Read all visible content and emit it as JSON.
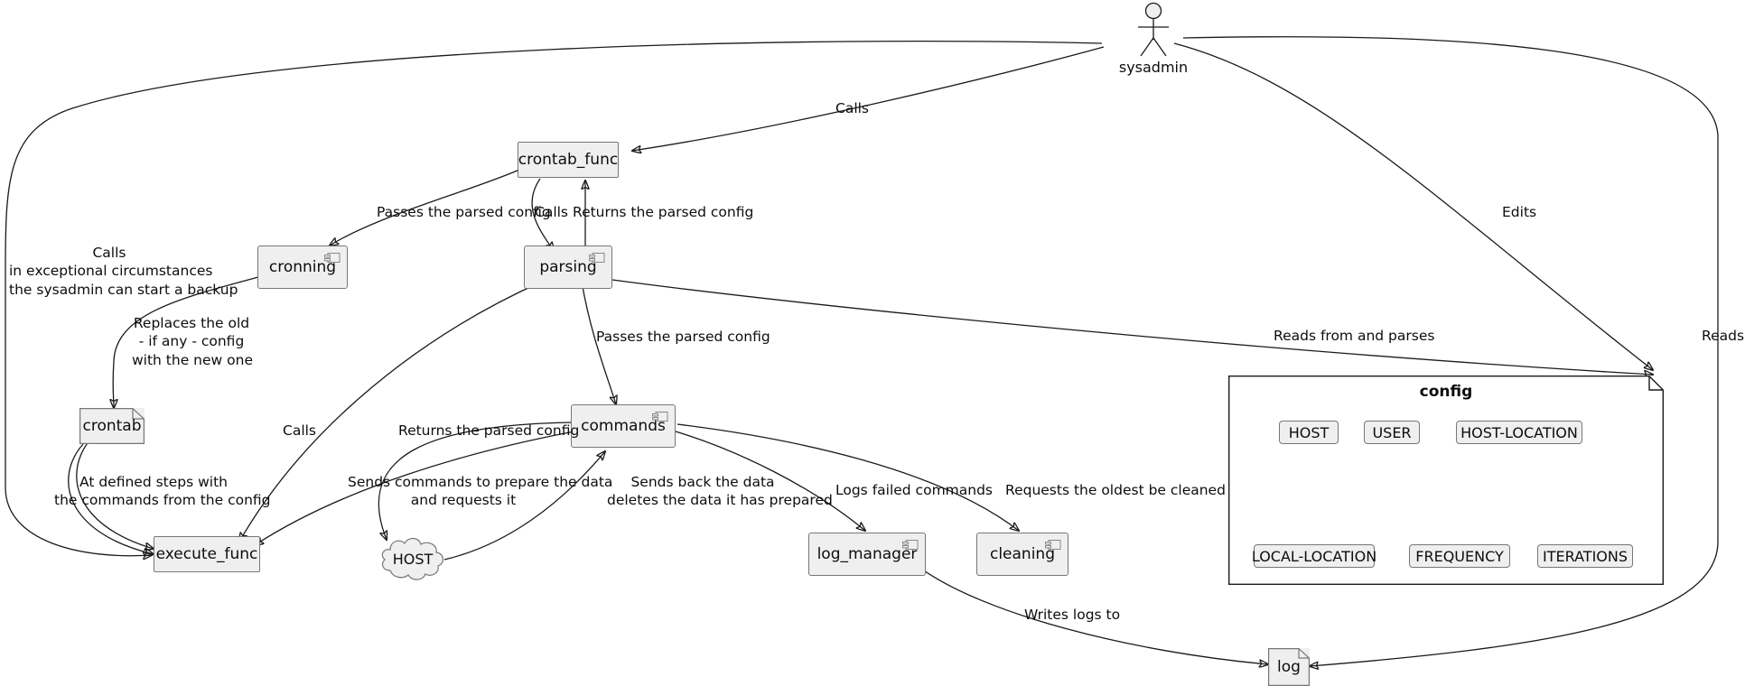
{
  "diagram": {
    "type": "uml-component-diagram",
    "background": "#ffffff",
    "node_fill": "#efefef",
    "node_stroke": "#777777",
    "edge_stroke": "#1a1a1a"
  },
  "actor": {
    "name": "sysadmin",
    "icon": "actor-stick-figure"
  },
  "components": [
    {
      "id": "crontab_func",
      "label": "crontab_func",
      "shape": "box",
      "has_component_icon": false
    },
    {
      "id": "cronning",
      "label": "cronning",
      "shape": "component",
      "has_component_icon": true
    },
    {
      "id": "parsing",
      "label": "parsing",
      "shape": "component",
      "has_component_icon": true
    },
    {
      "id": "commands",
      "label": "commands",
      "shape": "component",
      "has_component_icon": true
    },
    {
      "id": "log_manager",
      "label": "log_manager",
      "shape": "component",
      "has_component_icon": true
    },
    {
      "id": "cleaning",
      "label": "cleaning",
      "shape": "component",
      "has_component_icon": true
    },
    {
      "id": "execute_func",
      "label": "execute_func",
      "shape": "box",
      "has_component_icon": false
    }
  ],
  "artifacts": [
    {
      "id": "crontab",
      "label": "crontab",
      "shape": "artifact-folded-corner"
    },
    {
      "id": "log",
      "label": "log",
      "shape": "artifact-folded-corner"
    }
  ],
  "clouds": [
    {
      "id": "host",
      "label": "HOST",
      "shape": "cloud"
    }
  ],
  "package": {
    "id": "config",
    "title": "config",
    "shape": "note-folded-corner",
    "items_row1": [
      {
        "id": "cfg-host",
        "label": "HOST"
      },
      {
        "id": "cfg-user",
        "label": "USER"
      },
      {
        "id": "cfg-host-location",
        "label": "HOST-LOCATION"
      }
    ],
    "items_row2": [
      {
        "id": "cfg-local-location",
        "label": "LOCAL-LOCATION"
      },
      {
        "id": "cfg-frequency",
        "label": "FREQUENCY"
      },
      {
        "id": "cfg-iterations",
        "label": "ITERATIONS"
      }
    ]
  },
  "edge_labels": {
    "calls_sysadmin_crontab_func": "Calls",
    "edits": "Edits",
    "reads": "Reads",
    "reads_from_and_parses": "Reads from and parses",
    "passes_the_parsed_config_cronning": "Passes the parsed config",
    "calls_crontab_func_parsing": "Calls",
    "returns_the_parsed_config_parsing": "Returns the parsed config",
    "calls_exceptional_line1": "Calls",
    "calls_exceptional_line2": "in exceptional circumstances",
    "calls_exceptional_line3": "the sysadmin can start a backup",
    "replaces_line1": "Replaces the old",
    "replaces_line2": "- if any - config",
    "replaces_line3": "with the new one",
    "passes_the_parsed_config_commands": "Passes the parsed config",
    "calls_parsing_execute_func": "Calls",
    "at_defined_steps_line1": "At defined steps with",
    "at_defined_steps_line2": "the commands from the config",
    "returns_the_parsed_config_commands": "Returns the parsed config",
    "sends_commands_line1": "Sends commands to prepare the data",
    "sends_commands_line2": "and requests it",
    "sends_back_line1": "Sends back the data",
    "sends_back_line2": "deletes the data it has prepared",
    "logs_failed_commands": "Logs failed commands",
    "requests_the_oldest_be_cleaned": "Requests the oldest be cleaned",
    "writes_logs_to": "Writes logs to"
  }
}
